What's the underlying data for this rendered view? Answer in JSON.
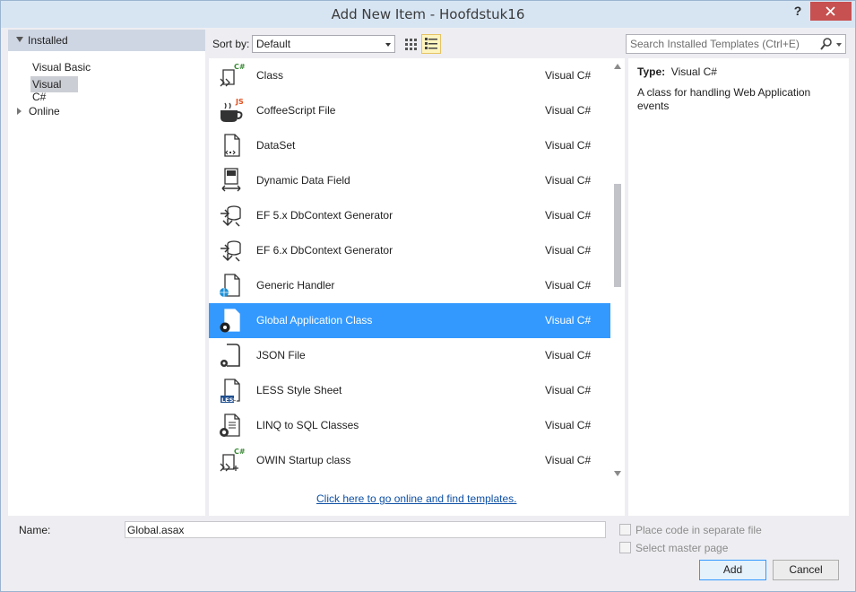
{
  "window": {
    "title": "Add New Item - Hoofdstuk16",
    "help_label": "?"
  },
  "tree": {
    "installed": "Installed",
    "visual_basic": "Visual Basic",
    "visual_csharp": "Visual C#",
    "online": "Online"
  },
  "toolbar": {
    "sort_label": "Sort by:",
    "sort_value": "Default",
    "search_placeholder": "Search Installed Templates (Ctrl+E)"
  },
  "templates": [
    {
      "name": "Class",
      "lang": "Visual C#",
      "icon": "class-icon"
    },
    {
      "name": "CoffeeScript File",
      "lang": "Visual C#",
      "icon": "coffee-icon"
    },
    {
      "name": "DataSet",
      "lang": "Visual C#",
      "icon": "dataset-icon"
    },
    {
      "name": "Dynamic Data Field",
      "lang": "Visual C#",
      "icon": "dynamic-data-icon"
    },
    {
      "name": "EF 5.x DbContext Generator",
      "lang": "Visual C#",
      "icon": "ef-generator-icon"
    },
    {
      "name": "EF 6.x DbContext Generator",
      "lang": "Visual C#",
      "icon": "ef-generator-icon"
    },
    {
      "name": "Generic Handler",
      "lang": "Visual C#",
      "icon": "generic-handler-icon"
    },
    {
      "name": "Global Application Class",
      "lang": "Visual C#",
      "icon": "global-class-icon",
      "selected": true
    },
    {
      "name": "JSON File",
      "lang": "Visual C#",
      "icon": "json-icon"
    },
    {
      "name": "LESS Style Sheet",
      "lang": "Visual C#",
      "icon": "less-icon"
    },
    {
      "name": "LINQ to SQL Classes",
      "lang": "Visual C#",
      "icon": "linq-icon"
    },
    {
      "name": "OWIN Startup class",
      "lang": "Visual C#",
      "icon": "owin-icon"
    }
  ],
  "online_link": "Click here to go online and find templates.",
  "details": {
    "type_label": "Type:",
    "type_value": "Visual C#",
    "description": "A class for handling Web Application events"
  },
  "footer": {
    "name_label": "Name:",
    "name_value": "Global.asax",
    "separate_file_label": "Place code in separate file",
    "master_page_label": "Select master page",
    "add_label": "Add",
    "cancel_label": "Cancel"
  }
}
